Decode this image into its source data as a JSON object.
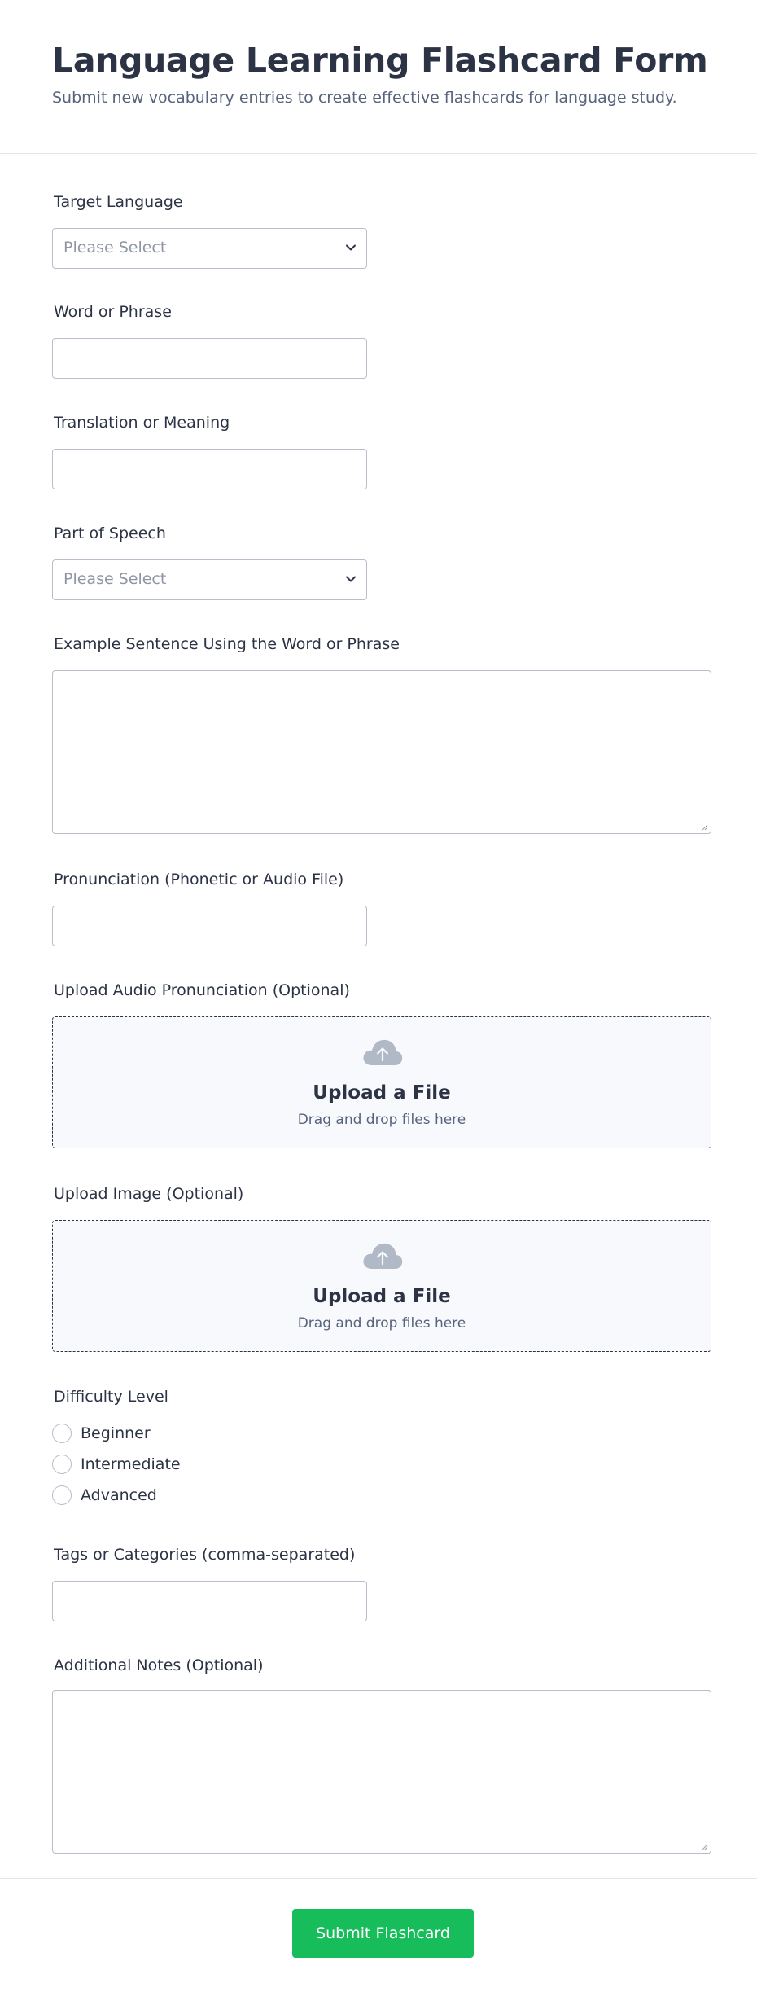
{
  "header": {
    "title": "Language Learning Flashcard Form",
    "subtitle": "Submit new vocabulary entries to create effective flashcards for language study."
  },
  "fields": {
    "target_language": {
      "label": "Target Language",
      "placeholder": "Please Select"
    },
    "word_or_phrase": {
      "label": "Word or Phrase",
      "value": ""
    },
    "translation": {
      "label": "Translation or Meaning",
      "value": ""
    },
    "part_of_speech": {
      "label": "Part of Speech",
      "placeholder": "Please Select"
    },
    "example_sentence": {
      "label": "Example Sentence Using the Word or Phrase",
      "value": ""
    },
    "pronunciation": {
      "label": "Pronunciation (Phonetic or Audio File)",
      "value": ""
    },
    "upload_audio": {
      "label": "Upload Audio Pronunciation (Optional)",
      "title": "Upload a File",
      "hint": "Drag and drop files here"
    },
    "upload_image": {
      "label": "Upload Image (Optional)",
      "title": "Upload a File",
      "hint": "Drag and drop files here"
    },
    "difficulty": {
      "label": "Difficulty Level",
      "options": [
        "Beginner",
        "Intermediate",
        "Advanced"
      ]
    },
    "tags": {
      "label": "Tags or Categories (comma-separated)",
      "value": ""
    },
    "notes": {
      "label": "Additional Notes (Optional)",
      "value": ""
    }
  },
  "footer": {
    "submit_label": "Submit Flashcard"
  },
  "icons": {
    "dropdown": "chevron-down-icon",
    "upload": "cloud-upload-icon",
    "resize": "resize-grip-icon"
  },
  "colors": {
    "text": "#2c3345",
    "muted": "#57647e",
    "placeholder": "#8f96a3",
    "border": "#b8bdc9",
    "upload_bg": "#f8f9fc",
    "upload_icon": "#b1b8c6",
    "submit": "#18bd5b"
  }
}
